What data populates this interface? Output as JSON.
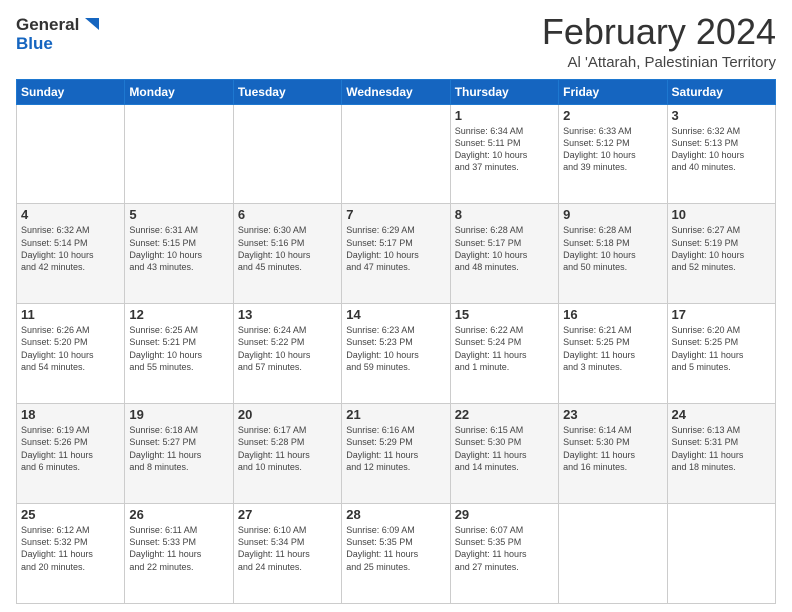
{
  "header": {
    "logo_line1": "General",
    "logo_line2": "Blue",
    "month": "February 2024",
    "location": "Al 'Attarah, Palestinian Territory"
  },
  "days_of_week": [
    "Sunday",
    "Monday",
    "Tuesday",
    "Wednesday",
    "Thursday",
    "Friday",
    "Saturday"
  ],
  "weeks": [
    [
      {
        "day": "",
        "info": ""
      },
      {
        "day": "",
        "info": ""
      },
      {
        "day": "",
        "info": ""
      },
      {
        "day": "",
        "info": ""
      },
      {
        "day": "1",
        "info": "Sunrise: 6:34 AM\nSunset: 5:11 PM\nDaylight: 10 hours\nand 37 minutes."
      },
      {
        "day": "2",
        "info": "Sunrise: 6:33 AM\nSunset: 5:12 PM\nDaylight: 10 hours\nand 39 minutes."
      },
      {
        "day": "3",
        "info": "Sunrise: 6:32 AM\nSunset: 5:13 PM\nDaylight: 10 hours\nand 40 minutes."
      }
    ],
    [
      {
        "day": "4",
        "info": "Sunrise: 6:32 AM\nSunset: 5:14 PM\nDaylight: 10 hours\nand 42 minutes."
      },
      {
        "day": "5",
        "info": "Sunrise: 6:31 AM\nSunset: 5:15 PM\nDaylight: 10 hours\nand 43 minutes."
      },
      {
        "day": "6",
        "info": "Sunrise: 6:30 AM\nSunset: 5:16 PM\nDaylight: 10 hours\nand 45 minutes."
      },
      {
        "day": "7",
        "info": "Sunrise: 6:29 AM\nSunset: 5:17 PM\nDaylight: 10 hours\nand 47 minutes."
      },
      {
        "day": "8",
        "info": "Sunrise: 6:28 AM\nSunset: 5:17 PM\nDaylight: 10 hours\nand 48 minutes."
      },
      {
        "day": "9",
        "info": "Sunrise: 6:28 AM\nSunset: 5:18 PM\nDaylight: 10 hours\nand 50 minutes."
      },
      {
        "day": "10",
        "info": "Sunrise: 6:27 AM\nSunset: 5:19 PM\nDaylight: 10 hours\nand 52 minutes."
      }
    ],
    [
      {
        "day": "11",
        "info": "Sunrise: 6:26 AM\nSunset: 5:20 PM\nDaylight: 10 hours\nand 54 minutes."
      },
      {
        "day": "12",
        "info": "Sunrise: 6:25 AM\nSunset: 5:21 PM\nDaylight: 10 hours\nand 55 minutes."
      },
      {
        "day": "13",
        "info": "Sunrise: 6:24 AM\nSunset: 5:22 PM\nDaylight: 10 hours\nand 57 minutes."
      },
      {
        "day": "14",
        "info": "Sunrise: 6:23 AM\nSunset: 5:23 PM\nDaylight: 10 hours\nand 59 minutes."
      },
      {
        "day": "15",
        "info": "Sunrise: 6:22 AM\nSunset: 5:24 PM\nDaylight: 11 hours\nand 1 minute."
      },
      {
        "day": "16",
        "info": "Sunrise: 6:21 AM\nSunset: 5:25 PM\nDaylight: 11 hours\nand 3 minutes."
      },
      {
        "day": "17",
        "info": "Sunrise: 6:20 AM\nSunset: 5:25 PM\nDaylight: 11 hours\nand 5 minutes."
      }
    ],
    [
      {
        "day": "18",
        "info": "Sunrise: 6:19 AM\nSunset: 5:26 PM\nDaylight: 11 hours\nand 6 minutes."
      },
      {
        "day": "19",
        "info": "Sunrise: 6:18 AM\nSunset: 5:27 PM\nDaylight: 11 hours\nand 8 minutes."
      },
      {
        "day": "20",
        "info": "Sunrise: 6:17 AM\nSunset: 5:28 PM\nDaylight: 11 hours\nand 10 minutes."
      },
      {
        "day": "21",
        "info": "Sunrise: 6:16 AM\nSunset: 5:29 PM\nDaylight: 11 hours\nand 12 minutes."
      },
      {
        "day": "22",
        "info": "Sunrise: 6:15 AM\nSunset: 5:30 PM\nDaylight: 11 hours\nand 14 minutes."
      },
      {
        "day": "23",
        "info": "Sunrise: 6:14 AM\nSunset: 5:30 PM\nDaylight: 11 hours\nand 16 minutes."
      },
      {
        "day": "24",
        "info": "Sunrise: 6:13 AM\nSunset: 5:31 PM\nDaylight: 11 hours\nand 18 minutes."
      }
    ],
    [
      {
        "day": "25",
        "info": "Sunrise: 6:12 AM\nSunset: 5:32 PM\nDaylight: 11 hours\nand 20 minutes."
      },
      {
        "day": "26",
        "info": "Sunrise: 6:11 AM\nSunset: 5:33 PM\nDaylight: 11 hours\nand 22 minutes."
      },
      {
        "day": "27",
        "info": "Sunrise: 6:10 AM\nSunset: 5:34 PM\nDaylight: 11 hours\nand 24 minutes."
      },
      {
        "day": "28",
        "info": "Sunrise: 6:09 AM\nSunset: 5:35 PM\nDaylight: 11 hours\nand 25 minutes."
      },
      {
        "day": "29",
        "info": "Sunrise: 6:07 AM\nSunset: 5:35 PM\nDaylight: 11 hours\nand 27 minutes."
      },
      {
        "day": "",
        "info": ""
      },
      {
        "day": "",
        "info": ""
      }
    ]
  ]
}
